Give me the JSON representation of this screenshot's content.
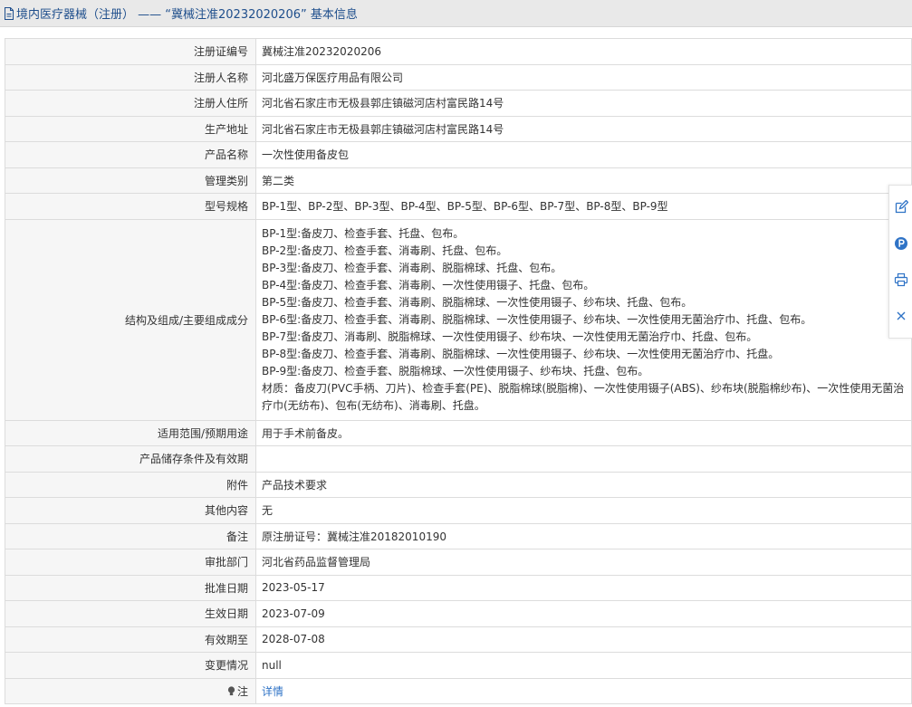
{
  "header": {
    "title": "境内医疗器械（注册） ——  “冀械注准20232020206” 基本信息"
  },
  "rows": [
    {
      "label": "注册证编号",
      "value": "冀械注准20232020206"
    },
    {
      "label": "注册人名称",
      "value": "河北盛万保医疗用品有限公司"
    },
    {
      "label": "注册人住所",
      "value": "河北省石家庄市无极县郭庄镇磁河店村富民路14号"
    },
    {
      "label": "生产地址",
      "value": "河北省石家庄市无极县郭庄镇磁河店村富民路14号"
    },
    {
      "label": "产品名称",
      "value": "一次性使用备皮包"
    },
    {
      "label": "管理类别",
      "value": "第二类"
    },
    {
      "label": "型号规格",
      "value": "BP-1型、BP-2型、BP-3型、BP-4型、BP-5型、BP-6型、BP-7型、BP-8型、BP-9型"
    }
  ],
  "composition": {
    "label": "结构及组成/主要组成成分",
    "lines": [
      "BP-1型:备皮刀、检查手套、托盘、包布。",
      "BP-2型:备皮刀、检查手套、消毒刷、托盘、包布。",
      "BP-3型:备皮刀、检查手套、消毒刷、脱脂棉球、托盘、包布。",
      "BP-4型:备皮刀、检查手套、消毒刷、一次性使用镊子、托盘、包布。",
      "BP-5型:备皮刀、检查手套、消毒刷、脱脂棉球、一次性使用镊子、纱布块、托盘、包布。",
      "BP-6型:备皮刀、检查手套、消毒刷、脱脂棉球、一次性使用镊子、纱布块、一次性使用无菌治疗巾、托盘、包布。",
      "BP-7型:备皮刀、消毒刷、脱脂棉球、一次性使用镊子、纱布块、一次性使用无菌治疗巾、托盘、包布。",
      "BP-8型:备皮刀、检查手套、消毒刷、脱脂棉球、一次性使用镊子、纱布块、一次性使用无菌治疗巾、托盘。",
      "BP-9型:备皮刀、检查手套、脱脂棉球、一次性使用镊子、纱布块、托盘、包布。",
      "材质：备皮刀(PVC手柄、刀片)、检查手套(PE)、脱脂棉球(脱脂棉)、一次性使用镊子(ABS)、纱布块(脱脂棉纱布)、一次性使用无菌治疗巾(无纺布)、包布(无纺布)、消毒刷、托盘。"
    ]
  },
  "rows2": [
    {
      "label": "适用范围/预期用途",
      "value": "用于手术前备皮。"
    },
    {
      "label": "产品储存条件及有效期",
      "value": ""
    },
    {
      "label": "附件",
      "value": "产品技术要求"
    },
    {
      "label": "其他内容",
      "value": "无"
    },
    {
      "label": "备注",
      "value": "原注册证号：冀械注准20182010190"
    },
    {
      "label": "审批部门",
      "value": "河北省药品监督管理局"
    },
    {
      "label": "批准日期",
      "value": "2023-05-17"
    },
    {
      "label": "生效日期",
      "value": "2023-07-09"
    },
    {
      "label": "有效期至",
      "value": "2028-07-08"
    },
    {
      "label": "变更情况",
      "value": "null"
    }
  ],
  "note": {
    "label": "注",
    "link": "详情"
  },
  "icons": {
    "header": "document-icon",
    "note": "lightbulb-icon",
    "sidebar": [
      "edit-icon",
      "parking-icon",
      "print-icon",
      "close-icon"
    ]
  },
  "colors": {
    "title": "#1e4e8c",
    "link": "#2f73c6",
    "sidebar_icon": "#2f73c6"
  }
}
